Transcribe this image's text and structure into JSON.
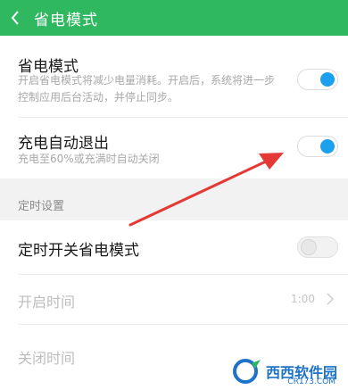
{
  "header": {
    "title": "省电模式"
  },
  "settings": {
    "power_saving": {
      "title": "省电模式",
      "description": "开启省电模式将减少电量消耗。开启后，系统将进一步控制应用后台活动，并停止同步。",
      "enabled": true
    },
    "auto_exit": {
      "title": "充电自动退出",
      "description": "充电至60%或充满时自动关闭",
      "enabled": true
    }
  },
  "schedule": {
    "section_title": "定时设置",
    "timer_toggle": {
      "title": "定时开关省电模式",
      "enabled": false
    },
    "start_time": {
      "label": "开启时间",
      "value": "1:00"
    },
    "end_time": {
      "label": "关闭时间"
    }
  },
  "watermark": {
    "text": "西西软件园",
    "url": "CR173.COM"
  },
  "colors": {
    "header_bg": "#2fb860",
    "toggle_on": "#1aa0ee",
    "arrow": "#e53935"
  }
}
